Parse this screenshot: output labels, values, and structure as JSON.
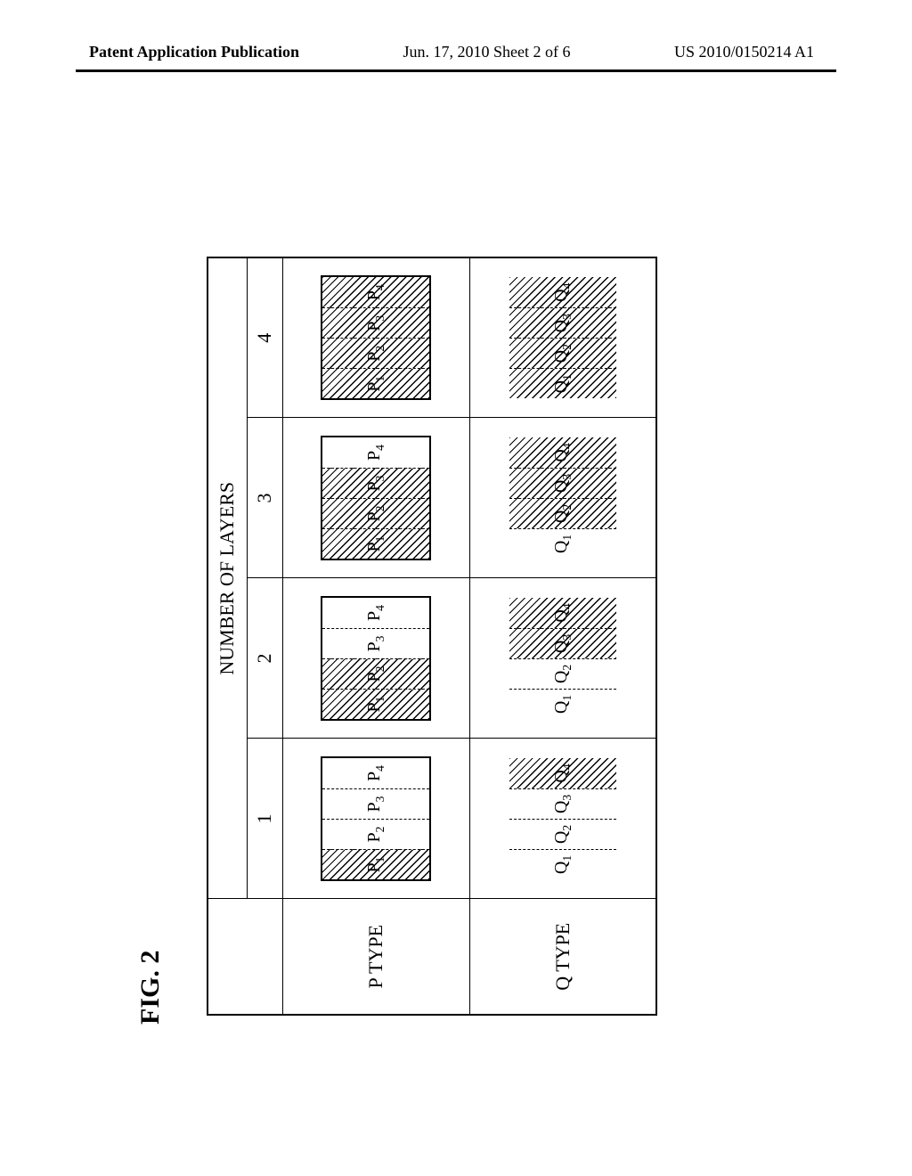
{
  "header": {
    "left": "Patent Application Publication",
    "center": "Jun. 17, 2010  Sheet 2 of 6",
    "right": "US 2010/0150214 A1"
  },
  "figure": {
    "label": "FIG. 2",
    "layers_header": "NUMBER OF LAYERS",
    "col_labels": [
      "1",
      "2",
      "3",
      "4"
    ],
    "row_labels": [
      "P TYPE",
      "Q TYPE"
    ],
    "P_parts": [
      "P",
      "P",
      "P",
      "P"
    ],
    "Q_parts": [
      "Q",
      "Q",
      "Q",
      "Q"
    ],
    "subs": [
      "1",
      "2",
      "3",
      "4"
    ]
  },
  "chart_data": {
    "type": "table",
    "title": "FIG. 2",
    "columns_header": "NUMBER OF LAYERS",
    "columns": [
      1,
      2,
      3,
      4
    ],
    "rows": [
      {
        "label": "P TYPE",
        "parts": [
          "P1",
          "P2",
          "P3",
          "P4"
        ],
        "hatched_by_column": {
          "1": [
            "P1"
          ],
          "2": [
            "P1",
            "P2"
          ],
          "3": [
            "P1",
            "P2",
            "P3"
          ],
          "4": [
            "P1",
            "P2",
            "P3",
            "P4"
          ]
        }
      },
      {
        "label": "Q TYPE",
        "parts": [
          "Q1",
          "Q2",
          "Q3",
          "Q4"
        ],
        "hatched_by_column": {
          "1": [
            "Q4"
          ],
          "2": [
            "Q3",
            "Q4"
          ],
          "3": [
            "Q2",
            "Q3",
            "Q4"
          ],
          "4": [
            "Q1",
            "Q2",
            "Q3",
            "Q4"
          ]
        }
      }
    ]
  }
}
